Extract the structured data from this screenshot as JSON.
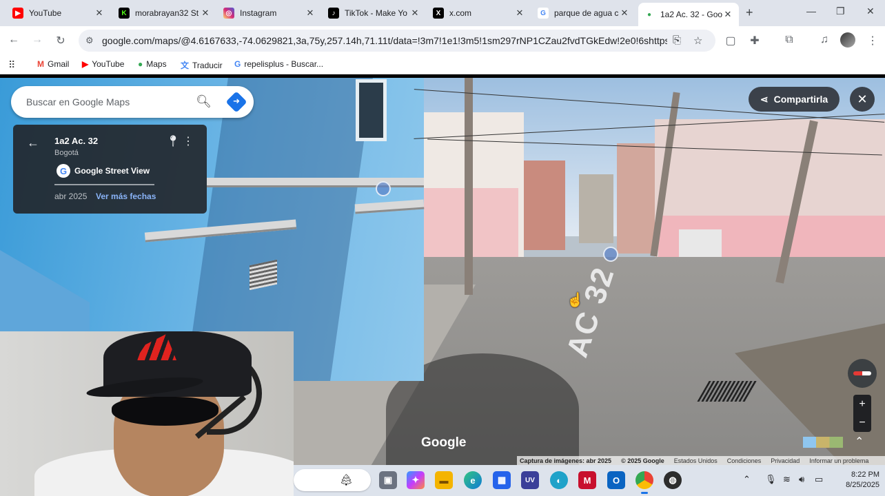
{
  "browser": {
    "tabs": [
      {
        "title": "YouTube",
        "icon": "youtube-icon",
        "color": "#ff0000",
        "glyph": "▶"
      },
      {
        "title": "morabrayan32 St",
        "icon": "kick-icon",
        "color": "#53fc18",
        "glyph": "K"
      },
      {
        "title": "Instagram",
        "icon": "instagram-icon",
        "color": "#d62976",
        "glyph": "◎"
      },
      {
        "title": "TikTok - Make Yo",
        "icon": "tiktok-icon",
        "color": "#000000",
        "glyph": "♪"
      },
      {
        "title": "x.com",
        "icon": "x-icon",
        "color": "#000000",
        "glyph": "X"
      },
      {
        "title": "parque de agua c",
        "icon": "google-icon",
        "color": "#4285f4",
        "glyph": "G"
      },
      {
        "title": "1a2 Ac. 32 - Goo",
        "icon": "maps-icon",
        "color": "#34a853",
        "glyph": "●",
        "active": true
      }
    ],
    "url": "google.com/maps/@4.6167633,-74.0629821,3a,75y,257.14h,71.11t/data=!3m7!1e1!3m5!1sm297rNP1CZau2fvdTGkEdw!2e0!6shttps:%2F%2...",
    "bookmarks": [
      {
        "label": "Gmail",
        "icon": "gmail-icon",
        "color": "#ea4335",
        "glyph": "M"
      },
      {
        "label": "YouTube",
        "icon": "youtube-icon",
        "color": "#ff0000",
        "glyph": "▶"
      },
      {
        "label": "Maps",
        "icon": "maps-icon",
        "color": "#34a853",
        "glyph": "●"
      },
      {
        "label": "Traducir",
        "icon": "translate-icon",
        "color": "#4285f4",
        "glyph": "文"
      },
      {
        "label": "repelisplus - Buscar...",
        "icon": "google-icon",
        "color": "#4285f4",
        "glyph": "G"
      }
    ]
  },
  "maps": {
    "search_placeholder": "Buscar en Google Maps",
    "place_title": "1a2 Ac. 32",
    "place_city": "Bogotá",
    "source_label": "Google Street View",
    "capture_date": "abr 2025",
    "more_dates_label": "Ver más fechas",
    "share_label": "Compartirla",
    "google_logo": "Google",
    "attribution": {
      "capture": "Captura de imágenes: abr 2025",
      "copyright": "© 2025 Google",
      "country": "Estados Unidos",
      "terms": "Condiciones",
      "privacy": "Privacidad",
      "report": "Informar un problema"
    },
    "road_marking": "AC 32",
    "zoom_in": "+",
    "zoom_out": "−"
  },
  "taskbar": {
    "apps": [
      {
        "name": "taskview-icon",
        "color": "#6b7280",
        "glyph": "▣"
      },
      {
        "name": "copilot-icon",
        "color": "#7b61ff",
        "glyph": "✦"
      },
      {
        "name": "file-explorer-icon",
        "color": "#f4b400",
        "glyph": "▬"
      },
      {
        "name": "edge-icon",
        "color": "#0f7bd6",
        "glyph": "e"
      },
      {
        "name": "store-icon",
        "color": "#2563eb",
        "glyph": "▦"
      },
      {
        "name": "ultraviewer-icon",
        "color": "#3b3f99",
        "glyph": "UV"
      },
      {
        "name": "chatgpt-icon",
        "color": "#1fa2c9",
        "glyph": "◐"
      },
      {
        "name": "mcafee-icon",
        "color": "#c8102e",
        "glyph": "M"
      },
      {
        "name": "outlook-icon",
        "color": "#0a64c2",
        "glyph": "O"
      },
      {
        "name": "chrome-icon",
        "color": "#ea4335",
        "glyph": "◉",
        "active": true
      },
      {
        "name": "obs-icon",
        "color": "#2d2d2d",
        "glyph": "◍"
      }
    ],
    "time": "8:22 PM",
    "date": "8/25/2025"
  }
}
